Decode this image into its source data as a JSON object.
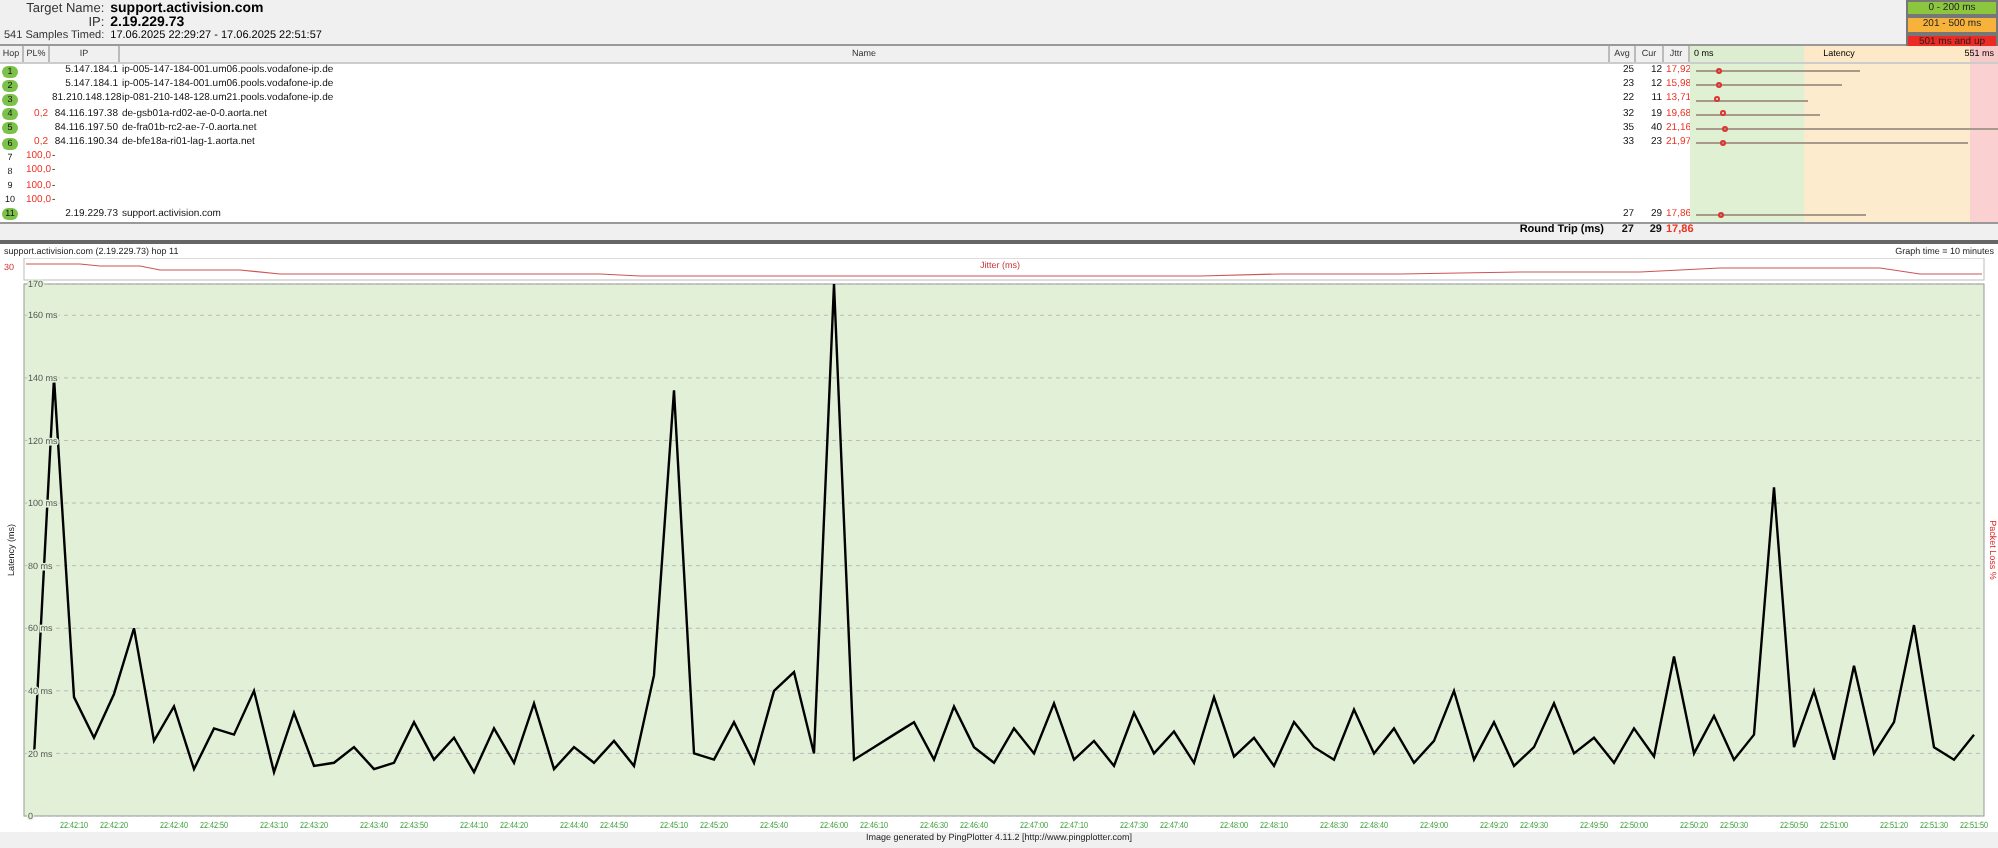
{
  "header": {
    "target_label": "Target Name:",
    "target": "support.activision.com",
    "ip_label": "IP:",
    "ip": "2.19.229.73",
    "samples_label": "541 Samples Timed:",
    "samples_range": "17.06.2025 22:29:27 - 17.06.2025 22:51:57"
  },
  "legend": [
    {
      "label": "0 - 200 ms",
      "color": "#8cc63f"
    },
    {
      "label": "201 - 500 ms",
      "color": "#f7b23b"
    },
    {
      "label": "501 ms and up",
      "color": "#ee2a24"
    }
  ],
  "table": {
    "columns": [
      "Hop",
      "PL%",
      "IP",
      "Name",
      "Avg",
      "Cur",
      "Jttr"
    ],
    "latency_header": {
      "min": "0 ms",
      "title": "Latency",
      "max": "551 ms"
    },
    "rows": [
      {
        "hop": "1",
        "responded": true,
        "pl": "",
        "ip": "5.147.184.1",
        "name": "ip-005-147-184-001.um06.pools.vodafone-ip.de",
        "avg": "25",
        "cur": "12",
        "jttr": "17,92",
        "level": 0.54
      },
      {
        "hop": "2",
        "responded": true,
        "pl": "",
        "ip": "5.147.184.1",
        "name": "ip-005-147-184-001.um06.pools.vodafone-ip.de",
        "avg": "23",
        "cur": "12",
        "jttr": "15,98",
        "level": 0.48
      },
      {
        "hop": "3",
        "responded": true,
        "pl": "",
        "ip": "81.210.148.128",
        "name": "ip-081-210-148-128.um21.pools.vodafone-ip.de",
        "avg": "22",
        "cur": "11",
        "jttr": "13,71",
        "level": 0.37
      },
      {
        "hop": "4",
        "responded": true,
        "pl": "0,2",
        "ip": "84.116.197.38",
        "name": "de-gsb01a-rd02-ae-0-0.aorta.net",
        "avg": "32",
        "cur": "19",
        "jttr": "19,68",
        "level": 0.41
      },
      {
        "hop": "5",
        "responded": true,
        "pl": "",
        "ip": "84.116.197.50",
        "name": "de-fra01b-rc2-ae-7-0.aorta.net",
        "avg": "35",
        "cur": "40",
        "jttr": "21,16",
        "level": 1.0
      },
      {
        "hop": "6",
        "responded": true,
        "pl": "0,2",
        "ip": "84.116.190.34",
        "name": "de-bfe18a-ri01-lag-1.aorta.net",
        "avg": "33",
        "cur": "23",
        "jttr": "21,97",
        "level": 0.9
      },
      {
        "hop": "7",
        "responded": false,
        "pl": "100,0",
        "ip": "-",
        "name": "",
        "avg": "",
        "cur": "",
        "jttr": ""
      },
      {
        "hop": "8",
        "responded": false,
        "pl": "100,0",
        "ip": "-",
        "name": "",
        "avg": "",
        "cur": "",
        "jttr": ""
      },
      {
        "hop": "9",
        "responded": false,
        "pl": "100,0",
        "ip": "-",
        "name": "",
        "avg": "",
        "cur": "",
        "jttr": ""
      },
      {
        "hop": "10",
        "responded": false,
        "pl": "100,0",
        "ip": "-",
        "name": "",
        "avg": "",
        "cur": "",
        "jttr": ""
      },
      {
        "hop": "11",
        "responded": true,
        "pl": "",
        "ip": "2.19.229.73",
        "name": "support.activision.com",
        "avg": "27",
        "cur": "29",
        "jttr": "17,86",
        "level": 0.56
      }
    ],
    "footer": {
      "label": "Round Trip (ms)",
      "avg": "27",
      "cur": "29",
      "jttr": "17,86"
    }
  },
  "graph": {
    "title": "support.activision.com (2.19.229.73) hop 11",
    "graph_time": "Graph time = 10 minutes",
    "jitter_label": "Jitter (ms)",
    "jitter_max": "30",
    "right_label": "Packet Loss %",
    "chart_data": {
      "type": "line",
      "ylabel": "Latency (ms)",
      "grid": true,
      "categories": [
        null,
        null,
        "22:42:10",
        null,
        "22:42:20",
        null,
        null,
        "22:42:40",
        null,
        "22:42:50",
        null,
        null,
        "22:43:10",
        null,
        "22:43:20",
        null,
        null,
        "22:43:40",
        null,
        "22:43:50",
        null,
        null,
        "22:44:10",
        null,
        "22:44:20",
        null,
        null,
        "22:44:40",
        null,
        "22:44:50",
        null,
        null,
        "22:45:10",
        null,
        "22:45:20",
        null,
        null,
        "22:45:40",
        null,
        null,
        "22:46:00",
        null,
        "22:46:10",
        null,
        null,
        "22:46:30",
        null,
        "22:46:40",
        null,
        null,
        "22:47:00",
        null,
        "22:47:10",
        null,
        null,
        "22:47:30",
        null,
        "22:47:40",
        null,
        null,
        "22:48:00",
        null,
        "22:48:10",
        null,
        null,
        "22:48:30",
        null,
        "22:48:40",
        null,
        null,
        "22:49:00",
        null,
        null,
        "22:49:20",
        null,
        "22:49:30",
        null,
        null,
        "22:49:50",
        null,
        "22:50:00",
        null,
        null,
        "22:50:20",
        null,
        "22:50:30",
        null,
        null,
        "22:50:50",
        null,
        "22:51:00",
        null,
        null,
        "22:51:20",
        null,
        "22:51:30",
        null,
        "22:51:50"
      ],
      "ylim": [
        0,
        170
      ],
      "yticks": [
        {
          "value": 170,
          "label": "170"
        },
        {
          "value": 160,
          "label": "160 ms"
        },
        {
          "value": 140,
          "label": "140 ms"
        },
        {
          "value": 120,
          "label": "120 ms"
        },
        {
          "value": 100,
          "label": "100 ms"
        },
        {
          "value": 80,
          "label": "80 ms"
        },
        {
          "value": 60,
          "label": "60 ms"
        },
        {
          "value": 40,
          "label": "40 ms"
        },
        {
          "value": 20,
          "label": "20 ms"
        },
        {
          "value": 0,
          "label": "0"
        }
      ],
      "series": [
        {
          "color": "#000000",
          "values": [
            19,
            140,
            38,
            25,
            39,
            60,
            24,
            35,
            15,
            28,
            26,
            40,
            14,
            33,
            16,
            17,
            22,
            15,
            17,
            30,
            18,
            25,
            14,
            28,
            17,
            36,
            15,
            22,
            17,
            24,
            16,
            45,
            136,
            20,
            18,
            30,
            17,
            40,
            46,
            20,
            170,
            18,
            22,
            26,
            30,
            18,
            35,
            22,
            17,
            28,
            20,
            36,
            18,
            24,
            16,
            33,
            20,
            27,
            17,
            38,
            19,
            25,
            16,
            30,
            22,
            18,
            34,
            20,
            28,
            17,
            24,
            40,
            18,
            30,
            16,
            22,
            36,
            20,
            25,
            17,
            28,
            19,
            51,
            20,
            32,
            18,
            26,
            105,
            22,
            40,
            18,
            48,
            20,
            30,
            61,
            22,
            18,
            26
          ]
        }
      ]
    }
  },
  "credit": "Image generated by PingPlotter 4.11.2 [http://www.pingplotter.com]"
}
